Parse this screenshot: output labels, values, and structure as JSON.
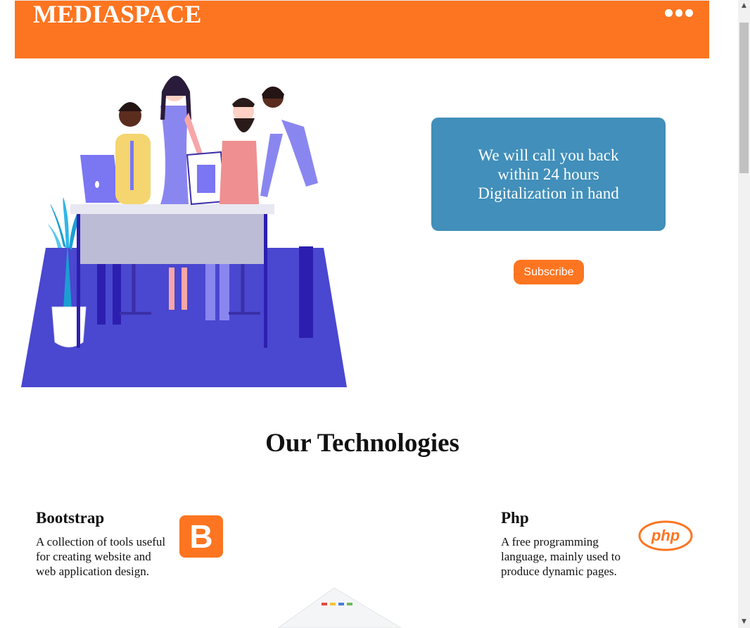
{
  "header": {
    "brand": "MEDIASPACE",
    "menu_icon": "more-dots-icon",
    "background_color": "#fd7520"
  },
  "hero": {
    "illustration": "team-working-at-desk-illustration",
    "callback_lines": [
      "We will call you back",
      "within 24 hours",
      "Digitalization in hand"
    ],
    "callback_color": "#418fba",
    "subscribe_label": "Subscribe"
  },
  "technologies": {
    "title": "Our Technologies",
    "items": [
      {
        "name": "Bootstrap",
        "description": "A collection of tools useful for creating website and web application design.",
        "logo_letter": "B",
        "logo_icon": "bootstrap-logo-icon"
      },
      {
        "name": "Php",
        "description": "A free programming language, mainly used to produce dynamic pages.",
        "logo_text": "php",
        "logo_icon": "php-logo-icon"
      }
    ]
  },
  "accent_color": "#fd7520"
}
